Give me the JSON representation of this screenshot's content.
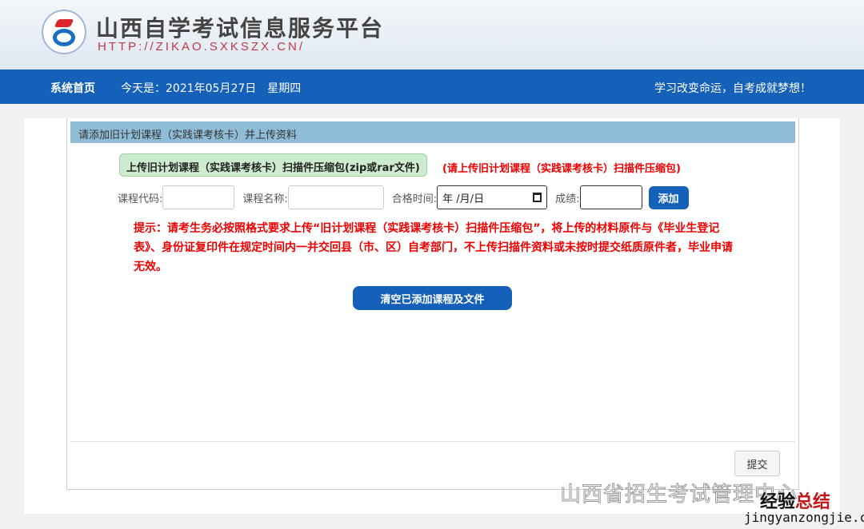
{
  "header": {
    "title": "山西自学考试信息服务平台",
    "url": "HTTP://ZIKAO.SXKSZX.CN/"
  },
  "nav": {
    "home": "系统首页",
    "date": "今天是：2021年05月27日　星期四",
    "slogan": "学习改变命运，自考成就梦想！"
  },
  "panel": {
    "title": "请添加旧计划课程（实践课考核卡）并上传资料",
    "upload_label": "上传旧计划课程（实践课考核卡）扫描件压缩包(zip或rar文件)",
    "upload_hint": "(请上传旧计划课程（实践课考核卡）扫描件压缩包)",
    "course_code_label": "课程代码:",
    "course_name_label": "课程名称:",
    "pass_date_label": "合格时间:",
    "date_placeholder": "年 /月/日",
    "score_label": "成绩:",
    "add_button": "添加",
    "notice": "提示：请考生务必按照格式要求上传“旧计划课程（实践课考核卡）扫描件压缩包”，将上传的材料原件与《毕业生登记表》、身份证复印件在规定时间内一并交回县（市、区）自考部门，不上传扫描件资料或未按时提交纸质原件者，毕业申请无效。",
    "clear_button": "清空已添加课程及文件",
    "submit_button": "提交"
  },
  "watermark": {
    "wechat": "山西省招生考试管理中心",
    "brand_a": "经验",
    "brand_b": "总结",
    "site": "jingyanzongjie.com"
  }
}
